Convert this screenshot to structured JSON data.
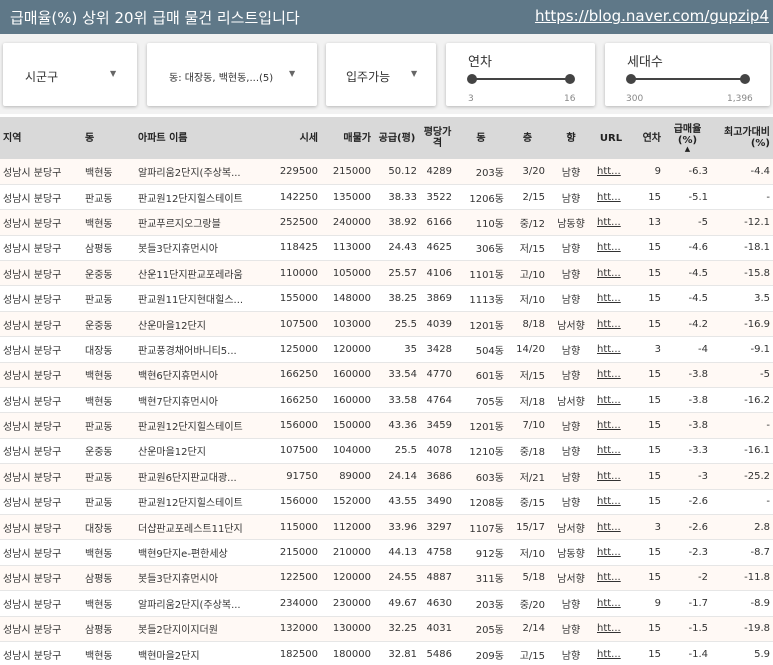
{
  "header": {
    "title": "급매율(%) 상위 20위 급매 물건 리스트입니다",
    "link": "https://blog.naver.com/gupzip4"
  },
  "filters": {
    "sigungu": "시군구",
    "dong": "동: 대장동, 백현동,...(5)",
    "move_in": "입주가능",
    "years": {
      "label": "연차",
      "min": "3",
      "max": "16"
    },
    "households": {
      "label": "세대수",
      "min": "300",
      "max": "1,396"
    }
  },
  "columns": [
    "지역",
    "동",
    "아파트 이름",
    "시세",
    "매물가",
    "공급(평)",
    "평당가격",
    "동",
    "층",
    "향",
    "URL",
    "연차",
    "급매율(%)",
    "최고가대비(%)"
  ],
  "sort_indicator": "▲",
  "rows": [
    [
      "성남시 분당구",
      "백현동",
      "알파리움2단지(주상복...",
      "229500",
      "215000",
      "50.12",
      "4289",
      "203동",
      "3/20",
      "남향",
      "htt...",
      "9",
      "-6.3",
      "-4.4"
    ],
    [
      "성남시 분당구",
      "판교동",
      "판교원12단지힐스테이트",
      "142250",
      "135000",
      "38.33",
      "3522",
      "1206동",
      "2/15",
      "남향",
      "htt...",
      "15",
      "-5.1",
      "-"
    ],
    [
      "성남시 분당구",
      "백현동",
      "판교푸르지오그랑블",
      "252500",
      "240000",
      "38.92",
      "6166",
      "110동",
      "중/12",
      "남동향",
      "htt...",
      "13",
      "-5",
      "-12.1"
    ],
    [
      "성남시 분당구",
      "삼평동",
      "봇들3단지휴먼시아",
      "118425",
      "113000",
      "24.43",
      "4625",
      "306동",
      "저/15",
      "남향",
      "htt...",
      "15",
      "-4.6",
      "-18.1"
    ],
    [
      "성남시 분당구",
      "운중동",
      "산운11단지판교포레라움",
      "110000",
      "105000",
      "25.57",
      "4106",
      "1101동",
      "고/10",
      "남향",
      "htt...",
      "15",
      "-4.5",
      "-15.8"
    ],
    [
      "성남시 분당구",
      "판교동",
      "판교원11단지현대힐스...",
      "155000",
      "148000",
      "38.25",
      "3869",
      "1113동",
      "저/10",
      "남향",
      "htt...",
      "15",
      "-4.5",
      "3.5"
    ],
    [
      "성남시 분당구",
      "운중동",
      "산운마을12단지",
      "107500",
      "103000",
      "25.5",
      "4039",
      "1201동",
      "8/18",
      "남서향",
      "htt...",
      "15",
      "-4.2",
      "-16.9"
    ],
    [
      "성남시 분당구",
      "대장동",
      "판교풍경채어바니티5...",
      "125000",
      "120000",
      "35",
      "3428",
      "504동",
      "14/20",
      "남향",
      "htt...",
      "3",
      "-4",
      "-9.1"
    ],
    [
      "성남시 분당구",
      "백현동",
      "백현6단지휴먼시아",
      "166250",
      "160000",
      "33.54",
      "4770",
      "601동",
      "저/15",
      "남향",
      "htt...",
      "15",
      "-3.8",
      "-5"
    ],
    [
      "성남시 분당구",
      "백현동",
      "백현7단지휴먼시아",
      "166250",
      "160000",
      "33.58",
      "4764",
      "705동",
      "저/18",
      "남서향",
      "htt...",
      "15",
      "-3.8",
      "-16.2"
    ],
    [
      "성남시 분당구",
      "판교동",
      "판교원12단지힐스테이트",
      "156000",
      "150000",
      "43.36",
      "3459",
      "1201동",
      "7/10",
      "남향",
      "htt...",
      "15",
      "-3.8",
      "-"
    ],
    [
      "성남시 분당구",
      "운중동",
      "산운마을12단지",
      "107500",
      "104000",
      "25.5",
      "4078",
      "1210동",
      "중/18",
      "남향",
      "htt...",
      "15",
      "-3.3",
      "-16.1"
    ],
    [
      "성남시 분당구",
      "판교동",
      "판교원6단지판교대광...",
      "91750",
      "89000",
      "24.14",
      "3686",
      "603동",
      "저/21",
      "남향",
      "htt...",
      "15",
      "-3",
      "-25.2"
    ],
    [
      "성남시 분당구",
      "판교동",
      "판교원12단지힐스테이트",
      "156000",
      "152000",
      "43.55",
      "3490",
      "1208동",
      "중/15",
      "남향",
      "htt...",
      "15",
      "-2.6",
      "-"
    ],
    [
      "성남시 분당구",
      "대장동",
      "더샵판교포레스트11단지",
      "115000",
      "112000",
      "33.96",
      "3297",
      "1107동",
      "15/17",
      "남서향",
      "htt...",
      "3",
      "-2.6",
      "2.8"
    ],
    [
      "성남시 분당구",
      "백현동",
      "백현9단지e-편한세상",
      "215000",
      "210000",
      "44.13",
      "4758",
      "912동",
      "저/10",
      "남동향",
      "htt...",
      "15",
      "-2.3",
      "-8.7"
    ],
    [
      "성남시 분당구",
      "삼평동",
      "봇들3단지휴먼시아",
      "122500",
      "120000",
      "24.55",
      "4887",
      "311동",
      "5/18",
      "남서향",
      "htt...",
      "15",
      "-2",
      "-11.8"
    ],
    [
      "성남시 분당구",
      "백현동",
      "알파리움2단지(주상복...",
      "234000",
      "230000",
      "49.67",
      "4630",
      "203동",
      "중/20",
      "남향",
      "htt...",
      "9",
      "-1.7",
      "-8.9"
    ],
    [
      "성남시 분당구",
      "삼평동",
      "봇들2단지이지더원",
      "132000",
      "130000",
      "32.25",
      "4031",
      "205동",
      "2/14",
      "남향",
      "htt...",
      "15",
      "-1.5",
      "-19.8"
    ],
    [
      "성남시 분당구",
      "백현동",
      "백현마을2단지",
      "182500",
      "180000",
      "32.81",
      "5486",
      "209동",
      "고/15",
      "남향",
      "htt...",
      "15",
      "-1.4",
      "5.9"
    ]
  ]
}
